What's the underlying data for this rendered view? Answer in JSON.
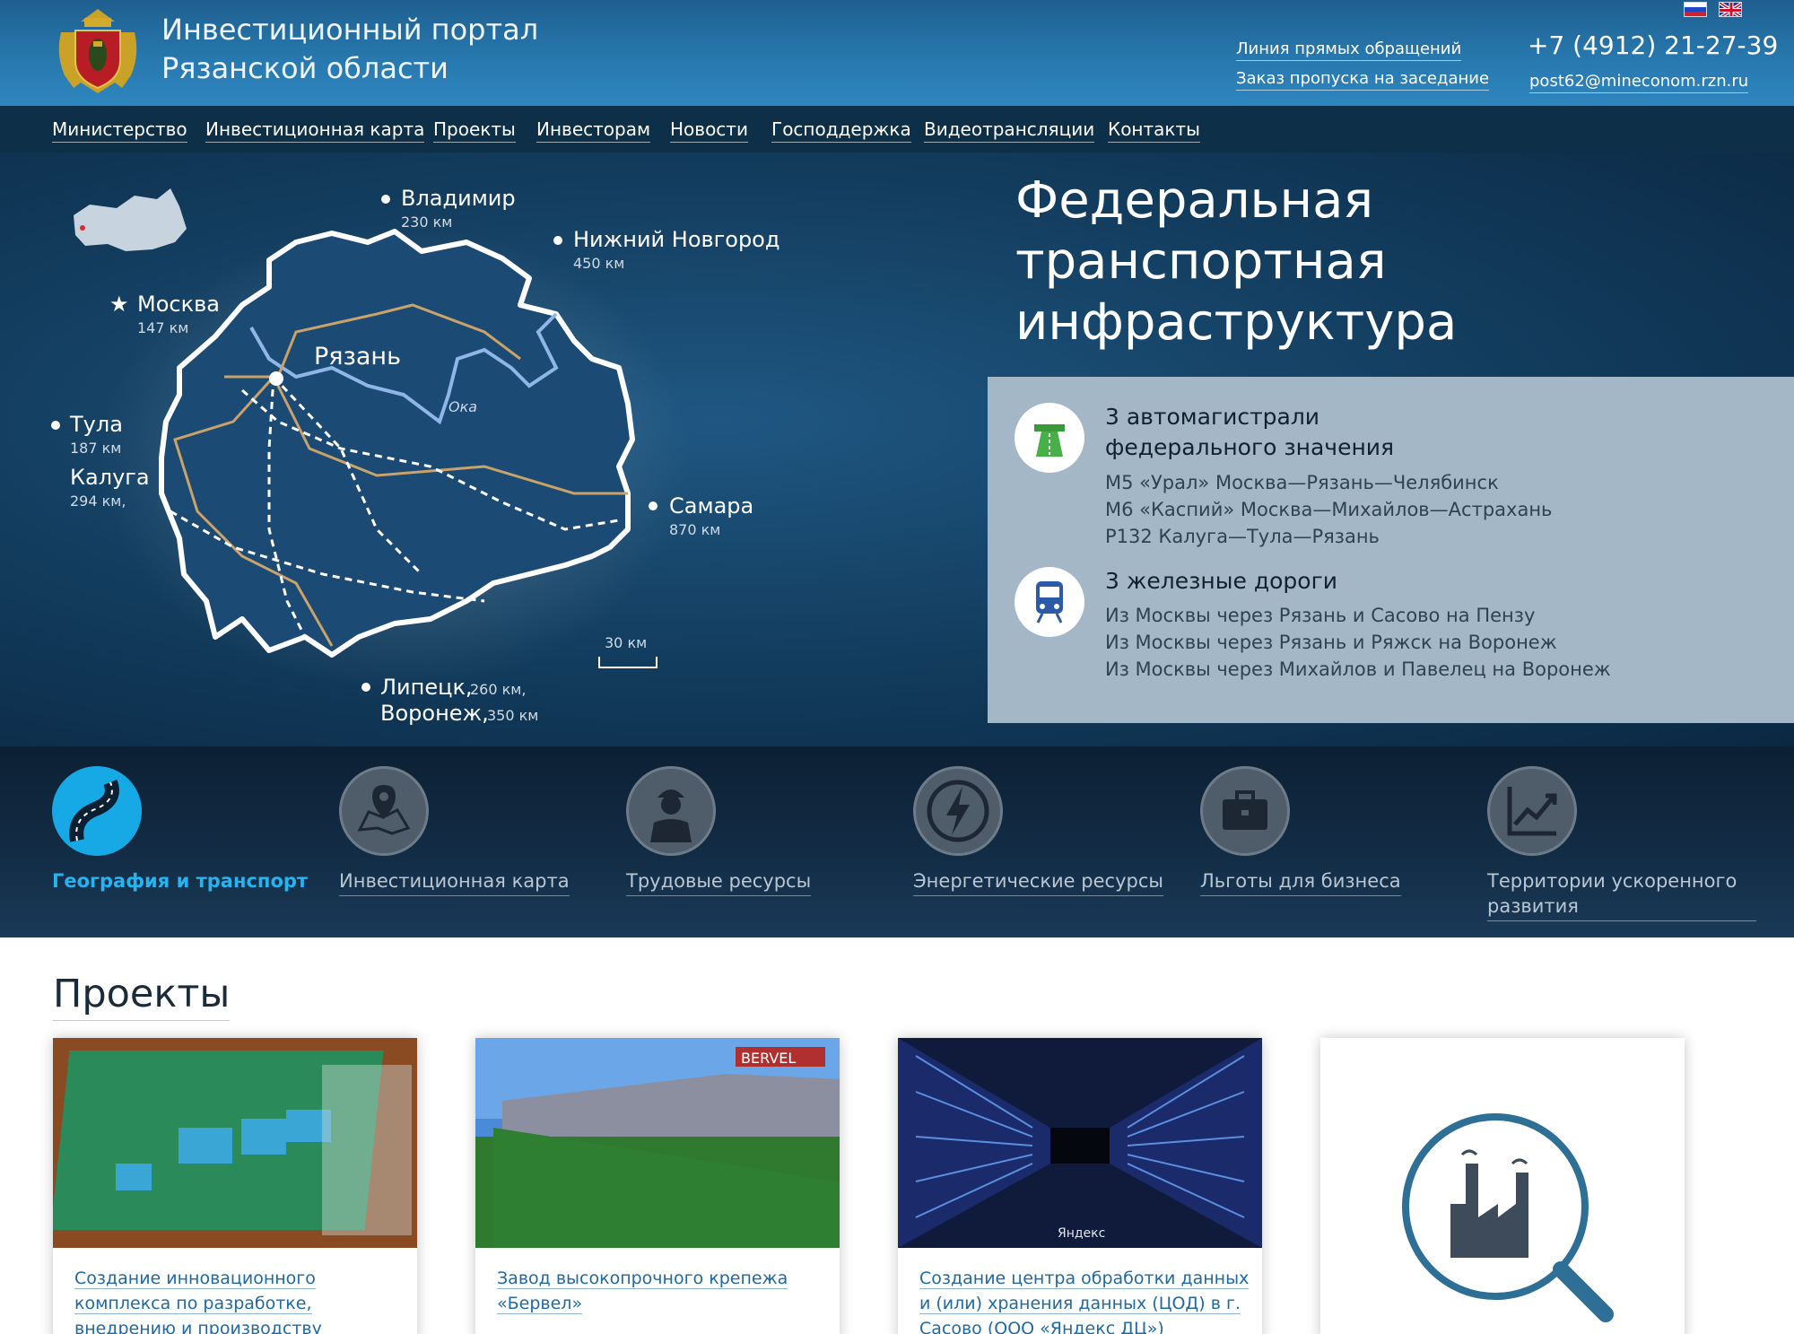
{
  "header": {
    "title_line1": "Инвестиционный портал",
    "title_line2": "Рязанской области",
    "links": [
      "Линия прямых обращений",
      "Заказ пропуска на заседание"
    ],
    "phone": "+7 (4912) 21-27-39",
    "email": "post62@mineconom.rzn.ru"
  },
  "nav": [
    "Министерство",
    "Инвестиционная карта",
    "Проекты",
    "Инвесторам",
    "Новости",
    "Господдержка",
    "Видеотрансляции",
    "Контакты"
  ],
  "map": {
    "cities": [
      {
        "name": "Владимир",
        "dist": "230 км"
      },
      {
        "name": "Нижний Новгород",
        "dist": "450 км"
      },
      {
        "name": "Москва",
        "dist": "147 км"
      },
      {
        "name": "Рязань",
        "dist": ""
      },
      {
        "name": "Тула",
        "dist": "187 км"
      },
      {
        "name": "Калуга",
        "dist": "294 км,"
      },
      {
        "name": "Самара",
        "dist": "870 км"
      }
    ],
    "river": "Ока",
    "scale": "30 км",
    "bottom_line1_city": "Липецк,",
    "bottom_line1_dist": "260 км,",
    "bottom_line2_city": "Воронеж,",
    "bottom_line2_dist": "350 км"
  },
  "hero": {
    "title_lines": [
      "Федеральная",
      "транспортная",
      "инфраструктура"
    ]
  },
  "info": {
    "roads_heading_1": "3 автомагистрали",
    "roads_heading_2": "федерального значения",
    "roads": [
      "М5 «Урал» Москва—Рязань—Челябинск",
      "М6 «Каспий» Москва—Михайлов—Астрахань",
      "Р132 Калуга—Тула—Рязань"
    ],
    "rail_heading": "3 железные дороги",
    "rails": [
      "Из Москвы через Рязань и Сасово на Пензу",
      "Из Москвы через Рязань и Ряжск на Воронеж",
      "Из Москвы через Михайлов и Павелец на Воронеж"
    ]
  },
  "categories": [
    {
      "label": "География и транспорт",
      "icon": "road-icon",
      "active": true
    },
    {
      "label": "Инвестиционная карта",
      "icon": "map-pin-icon",
      "active": false
    },
    {
      "label": "Трудовые ресурсы",
      "icon": "worker-icon",
      "active": false
    },
    {
      "label": "Энергетические ресурсы",
      "icon": "lightning-icon",
      "active": false
    },
    {
      "label": "Льготы для бизнеса",
      "icon": "briefcase-icon",
      "active": false
    },
    {
      "label": "Территории ускоренного развития",
      "icon": "growth-chart-icon",
      "active": false
    }
  ],
  "projects": {
    "title": "Проекты",
    "cards": [
      {
        "title": "Создание инновационного комплекса по разработке, внедрению и производству"
      },
      {
        "title": "Завод высокопрочного крепежа «Бервел»",
        "image_text": "BERVEL"
      },
      {
        "title": "Создание центра обработки данных и (или) хранения данных (ЦОД) в г. Сасово (ООО «Яндекс ДЦ»)",
        "image_text": "Яндекс"
      },
      {
        "title": ""
      }
    ]
  },
  "colors": {
    "header": "#2778ae",
    "nav": "#0e2f48",
    "accent": "#17a8e6",
    "link": "#1f6aa5"
  }
}
